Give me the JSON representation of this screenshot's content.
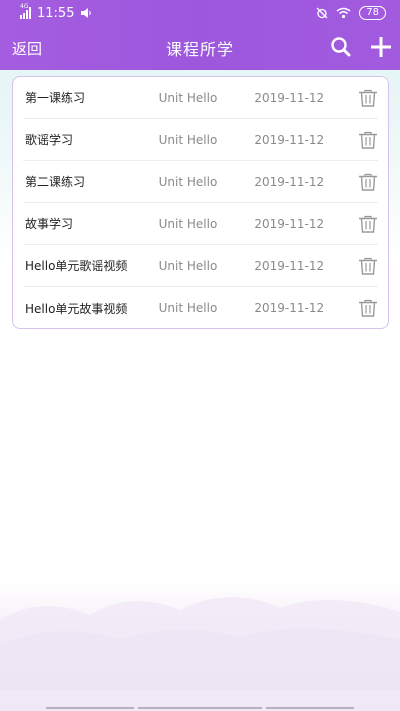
{
  "status_bar": {
    "network": "4G",
    "time": "11:55",
    "battery": "78"
  },
  "header": {
    "back_label": "返回",
    "title": "课程所学"
  },
  "icons": {
    "search": "search-icon",
    "add": "plus-icon",
    "delete": "trash-icon"
  },
  "colors": {
    "header": "#a05ade",
    "card_border": "#d5c3ee",
    "muted_text": "#8a8a8a"
  },
  "lessons": [
    {
      "name": "第一课练习",
      "unit": "Unit Hello",
      "date": "2019-11-12"
    },
    {
      "name": "歌谣学习",
      "unit": "Unit Hello",
      "date": "2019-11-12"
    },
    {
      "name": "第二课练习",
      "unit": "Unit Hello",
      "date": "2019-11-12"
    },
    {
      "name": "故事学习",
      "unit": "Unit Hello",
      "date": "2019-11-12"
    },
    {
      "name": "Hello单元歌谣视频",
      "unit": "Unit Hello",
      "date": "2019-11-12"
    },
    {
      "name": "Hello单元故事视频",
      "unit": "Unit Hello",
      "date": "2019-11-12"
    }
  ]
}
